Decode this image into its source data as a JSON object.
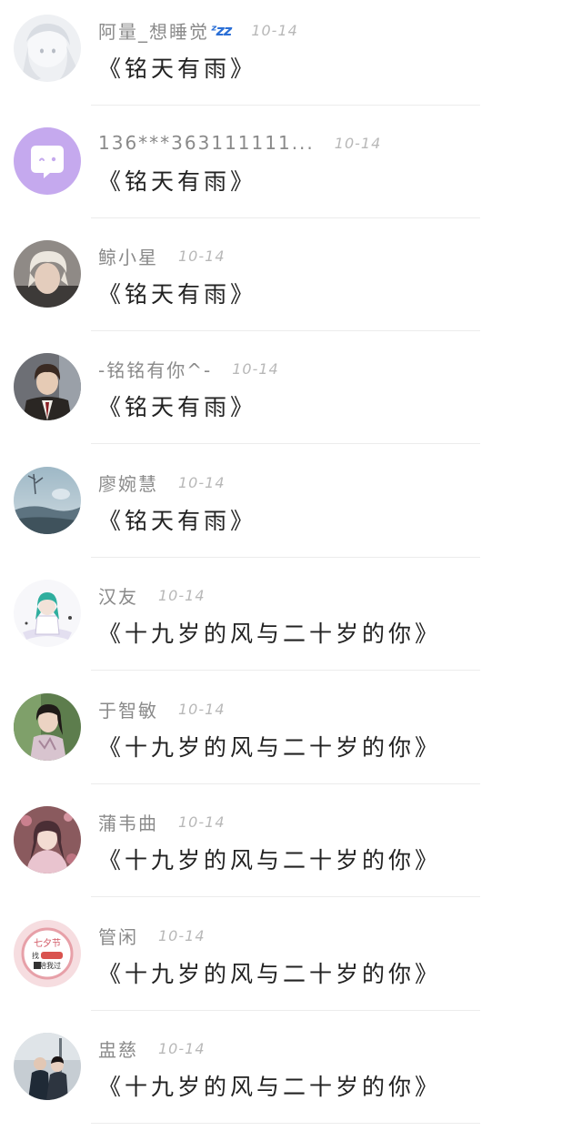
{
  "comments": [
    {
      "name": "阿量_想睡觉",
      "badge": "zzz",
      "date": "10-14",
      "title": "《铭天有雨》",
      "avatar": "avatar-white-haired-illustration"
    },
    {
      "name": "136***363111111...",
      "badge": "",
      "date": "10-14",
      "title": "《铭天有雨》",
      "avatar": "avatar-purple-chat-bubble"
    },
    {
      "name": "鲸小星",
      "badge": "",
      "date": "10-14",
      "title": "《铭天有雨》",
      "avatar": "avatar-blond-boy-photo"
    },
    {
      "name": "-铭铭有你^-",
      "badge": "",
      "date": "10-14",
      "title": "《铭天有雨》",
      "avatar": "avatar-school-uniform-photo"
    },
    {
      "name": "廖婉慧",
      "badge": "",
      "date": "10-14",
      "title": "《铭天有雨》",
      "avatar": "avatar-misty-landscape"
    },
    {
      "name": "汉友",
      "badge": "",
      "date": "10-14",
      "title": "《十九岁的风与二十岁的你》",
      "avatar": "avatar-green-haired-chibi"
    },
    {
      "name": "于智敏",
      "badge": "",
      "date": "10-14",
      "title": "《十九岁的风与二十岁的你》",
      "avatar": "avatar-kimono-girl-photo"
    },
    {
      "name": "蒲韦曲",
      "badge": "",
      "date": "10-14",
      "title": "《十九岁的风与二十岁的你》",
      "avatar": "avatar-pink-anime-girl"
    },
    {
      "name": "管闲",
      "badge": "",
      "date": "10-14",
      "title": "《十九岁的风与二十岁的你》",
      "avatar": "avatar-qixi-stamp",
      "avatar_text": {
        "top": "七夕节",
        "middle": "找",
        "bottom": "陪我过"
      }
    },
    {
      "name": "盅慈",
      "badge": "",
      "date": "10-14",
      "title": "《十九岁的风与二十岁的你》",
      "avatar": "avatar-couple-photo"
    }
  ]
}
